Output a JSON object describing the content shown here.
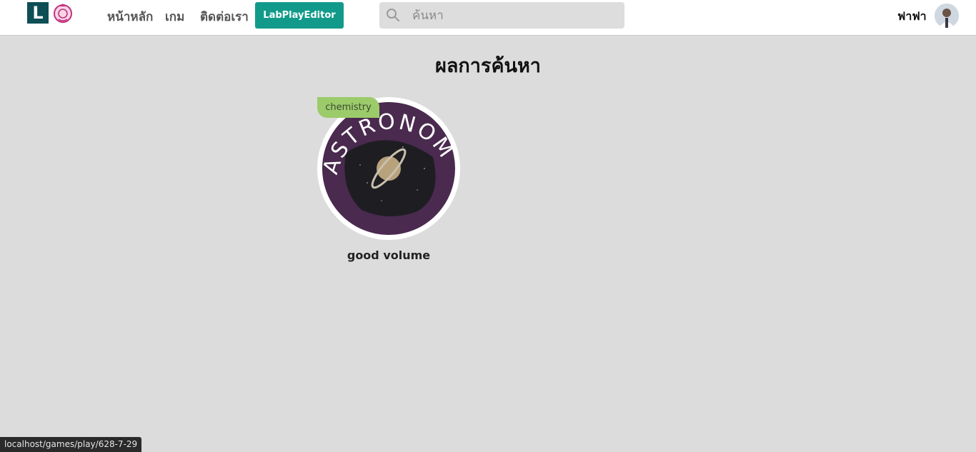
{
  "header": {
    "logo_letter": "L",
    "nav": {
      "home": "หน้าหลัก",
      "games": "เกม",
      "contact": "ติดต่อเรา",
      "editor_button": "LabPlayEditor"
    },
    "search": {
      "placeholder": "ค้นหา",
      "value": ""
    },
    "user": {
      "name": "ฟาฟา"
    }
  },
  "main": {
    "title": "ผลการค้นหา",
    "results": [
      {
        "category": "chemistry",
        "title": "good volume",
        "thumbnail_text": "ASTRONOMY"
      }
    ]
  },
  "status_bar": {
    "url": "localhost/games/play/628-7-29"
  },
  "colors": {
    "accent": "#119a8a",
    "logo": "#0d4f55",
    "badge": "#9ccb6a",
    "background": "#dcdcdc",
    "thumbnail_ring": "#4a2a4f"
  }
}
